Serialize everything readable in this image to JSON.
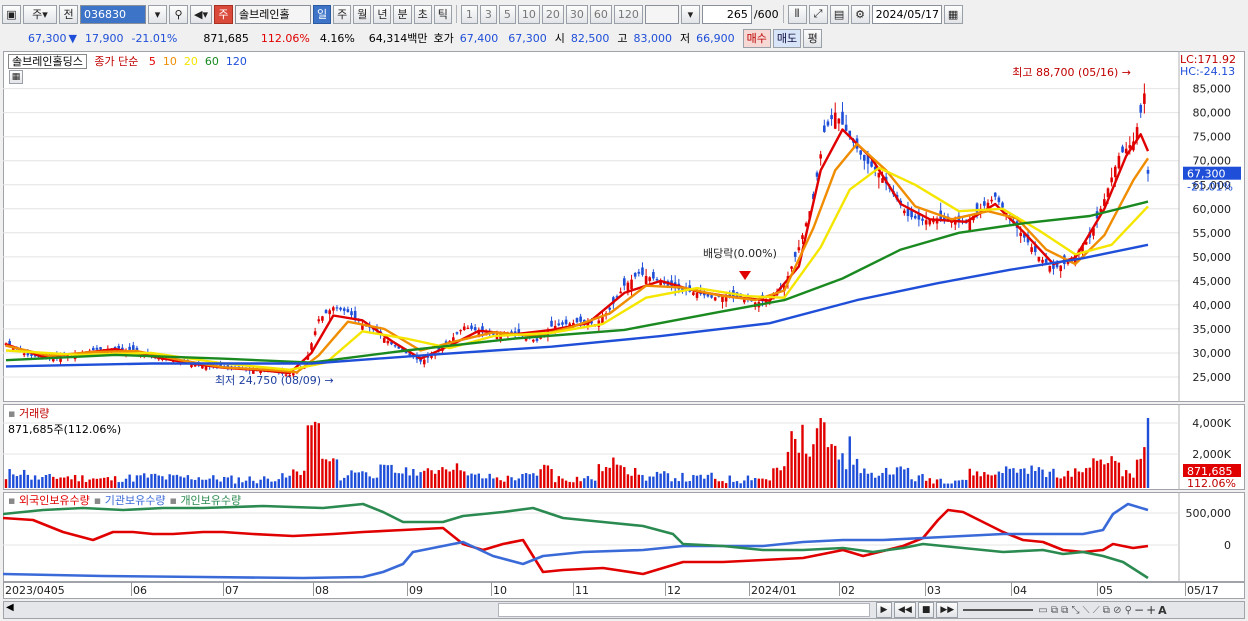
{
  "toolbar": {
    "market_label": "주",
    "type_label": "전",
    "code": "036830",
    "stock_name": "솔브레인홀",
    "stock_badge": "주",
    "periods": [
      "일",
      "주",
      "월",
      "년",
      "분",
      "초",
      "틱"
    ],
    "selected_period": "일",
    "minute_options": [
      "1",
      "3",
      "5",
      "10",
      "20",
      "30",
      "60",
      "120"
    ],
    "range_count": "265",
    "range_total": "/600",
    "date": "2024/05/17"
  },
  "quote": {
    "price": "67,300",
    "arrow": "▼",
    "change": "17,900",
    "change_pct": "-21.01%",
    "volume": "871,685",
    "volume_ratio": "112.06%",
    "turnover": "4.16%",
    "amount": "64,314백만",
    "bid_label": "호가",
    "ask_price": "67,400",
    "bid_price": "67,300",
    "open_label": "시",
    "open": "82,500",
    "high_label": "고",
    "high": "83,000",
    "low_label": "저",
    "low": "66,900",
    "buy_label": "매수",
    "sell_label": "매도",
    "eval_label": "평"
  },
  "chart_data": {
    "type": "candlestick",
    "stock": "솔브레인홀딩스",
    "legend": {
      "close_label": "종가 단순",
      "ma_periods": [
        "5",
        "10",
        "20",
        "60",
        "120"
      ],
      "ma_colors": [
        "#e00000",
        "#f08c00",
        "#f5e600",
        "#1a8a20",
        "#1f4fd8"
      ]
    },
    "ylim": [
      20000,
      92000
    ],
    "y_ticks": [
      25000,
      30000,
      35000,
      40000,
      45000,
      50000,
      55000,
      60000,
      65000,
      70000,
      75000,
      80000,
      85000
    ],
    "y_tick_labels": [
      "25,000",
      "30,000",
      "35,000",
      "40,000",
      "45,000",
      "50,000",
      "55,000",
      "60,000",
      "65,000",
      "70,000",
      "75,000",
      "80,000",
      "85,000"
    ],
    "x_labels": [
      "2023/04",
      "05",
      "06",
      "07",
      "08",
      "09",
      "10",
      "11",
      "12",
      "2024/01",
      "02",
      "03",
      "04",
      "05",
      "05/17"
    ],
    "annotations": {
      "high": "최고 88,700 (05/16)",
      "low": "최저 24,750 (08/09)",
      "dividend": "배당락(0.00%)",
      "lc": "LC:171.92",
      "hc": "HC:-24.13",
      "last_price": "67,300",
      "last_pct": "-21.01%"
    },
    "close_trend": [
      [
        0,
        32000
      ],
      [
        6,
        29500
      ],
      [
        12,
        28800
      ],
      [
        18,
        29800
      ],
      [
        24,
        30600
      ],
      [
        30,
        31000
      ],
      [
        36,
        30200
      ],
      [
        42,
        29000
      ],
      [
        48,
        28200
      ],
      [
        54,
        27300
      ],
      [
        60,
        26800
      ],
      [
        66,
        26500
      ],
      [
        72,
        26200
      ],
      [
        78,
        25400
      ],
      [
        82,
        27000
      ],
      [
        86,
        37000
      ],
      [
        90,
        39500
      ],
      [
        94,
        38500
      ],
      [
        98,
        36000
      ],
      [
        102,
        34500
      ],
      [
        106,
        31800
      ],
      [
        110,
        30000
      ],
      [
        114,
        28200
      ],
      [
        118,
        29800
      ],
      [
        122,
        32500
      ],
      [
        126,
        35500
      ],
      [
        130,
        34500
      ],
      [
        134,
        33800
      ],
      [
        138,
        34200
      ],
      [
        142,
        33500
      ],
      [
        146,
        32500
      ],
      [
        150,
        35500
      ],
      [
        154,
        36000
      ],
      [
        158,
        36500
      ],
      [
        162,
        36000
      ],
      [
        166,
        39000
      ],
      [
        170,
        44000
      ],
      [
        174,
        46500
      ],
      [
        178,
        45500
      ],
      [
        182,
        44000
      ],
      [
        186,
        43000
      ],
      [
        190,
        42500
      ],
      [
        194,
        41500
      ],
      [
        198,
        41800
      ],
      [
        202,
        41500
      ],
      [
        206,
        40500
      ],
      [
        210,
        41000
      ],
      [
        214,
        44000
      ],
      [
        218,
        52000
      ],
      [
        222,
        62000
      ],
      [
        225,
        76000
      ],
      [
        228,
        80000
      ],
      [
        232,
        75000
      ],
      [
        236,
        70000
      ],
      [
        240,
        67500
      ],
      [
        244,
        63000
      ],
      [
        248,
        58500
      ],
      [
        252,
        57500
      ],
      [
        256,
        58000
      ],
      [
        260,
        57500
      ],
      [
        264,
        57000
      ],
      [
        268,
        60000
      ],
      [
        272,
        62500
      ],
      [
        276,
        58000
      ],
      [
        280,
        54000
      ],
      [
        284,
        50000
      ],
      [
        288,
        47500
      ],
      [
        291,
        48500
      ],
      [
        294,
        50500
      ],
      [
        298,
        54000
      ],
      [
        302,
        62000
      ],
      [
        306,
        71000
      ],
      [
        310,
        74000
      ],
      [
        312,
        80000
      ],
      [
        313,
        84000
      ],
      [
        314,
        67300
      ]
    ],
    "moving_averages": [
      {
        "name": "5",
        "color": "#e00000",
        "points": [
          [
            0,
            31800
          ],
          [
            10,
            29200
          ],
          [
            20,
            29900
          ],
          [
            30,
            30800
          ],
          [
            40,
            29300
          ],
          [
            50,
            27900
          ],
          [
            60,
            26900
          ],
          [
            70,
            26400
          ],
          [
            78,
            25800
          ],
          [
            84,
            30000
          ],
          [
            90,
            37800
          ],
          [
            98,
            36800
          ],
          [
            106,
            32500
          ],
          [
            114,
            28800
          ],
          [
            122,
            31500
          ],
          [
            130,
            34600
          ],
          [
            140,
            33900
          ],
          [
            150,
            34800
          ],
          [
            160,
            36200
          ],
          [
            170,
            42500
          ],
          [
            180,
            45000
          ],
          [
            190,
            42800
          ],
          [
            200,
            41600
          ],
          [
            210,
            40900
          ],
          [
            218,
            48000
          ],
          [
            224,
            68000
          ],
          [
            230,
            76500
          ],
          [
            238,
            70500
          ],
          [
            246,
            61000
          ],
          [
            254,
            57800
          ],
          [
            264,
            57300
          ],
          [
            272,
            61000
          ],
          [
            280,
            55000
          ],
          [
            288,
            48500
          ],
          [
            294,
            49800
          ],
          [
            302,
            60000
          ],
          [
            308,
            71000
          ],
          [
            312,
            75500
          ],
          [
            314,
            72000
          ]
        ]
      },
      {
        "name": "10",
        "color": "#f08c00",
        "points": [
          [
            0,
            31500
          ],
          [
            12,
            29400
          ],
          [
            24,
            30200
          ],
          [
            36,
            30400
          ],
          [
            48,
            28500
          ],
          [
            60,
            27000
          ],
          [
            72,
            26500
          ],
          [
            80,
            26000
          ],
          [
            86,
            29500
          ],
          [
            94,
            36500
          ],
          [
            104,
            35000
          ],
          [
            114,
            30500
          ],
          [
            124,
            32500
          ],
          [
            134,
            34300
          ],
          [
            146,
            33500
          ],
          [
            156,
            35500
          ],
          [
            166,
            38200
          ],
          [
            176,
            44000
          ],
          [
            186,
            43600
          ],
          [
            196,
            42000
          ],
          [
            206,
            41000
          ],
          [
            214,
            43000
          ],
          [
            222,
            56000
          ],
          [
            228,
            68000
          ],
          [
            234,
            73500
          ],
          [
            242,
            68000
          ],
          [
            250,
            60500
          ],
          [
            260,
            57800
          ],
          [
            270,
            59500
          ],
          [
            278,
            58000
          ],
          [
            286,
            51500
          ],
          [
            294,
            48500
          ],
          [
            302,
            54500
          ],
          [
            310,
            66000
          ],
          [
            314,
            70500
          ]
        ]
      },
      {
        "name": "20",
        "color": "#f5e600",
        "points": [
          [
            0,
            30500
          ],
          [
            20,
            29600
          ],
          [
            40,
            30000
          ],
          [
            60,
            27800
          ],
          [
            78,
            26500
          ],
          [
            88,
            28000
          ],
          [
            98,
            34500
          ],
          [
            110,
            33000
          ],
          [
            122,
            31000
          ],
          [
            134,
            33500
          ],
          [
            150,
            34200
          ],
          [
            164,
            36000
          ],
          [
            176,
            41500
          ],
          [
            190,
            43500
          ],
          [
            204,
            41800
          ],
          [
            214,
            41500
          ],
          [
            224,
            52000
          ],
          [
            232,
            64000
          ],
          [
            240,
            68500
          ],
          [
            250,
            65000
          ],
          [
            262,
            59500
          ],
          [
            274,
            60000
          ],
          [
            284,
            55500
          ],
          [
            294,
            50500
          ],
          [
            304,
            52500
          ],
          [
            314,
            60500
          ]
        ]
      },
      {
        "name": "60",
        "color": "#1a8a20",
        "points": [
          [
            0,
            28500
          ],
          [
            30,
            29600
          ],
          [
            60,
            28800
          ],
          [
            84,
            28000
          ],
          [
            110,
            30500
          ],
          [
            140,
            33000
          ],
          [
            170,
            34800
          ],
          [
            196,
            38500
          ],
          [
            214,
            41000
          ],
          [
            230,
            45500
          ],
          [
            246,
            51500
          ],
          [
            262,
            55000
          ],
          [
            280,
            57000
          ],
          [
            298,
            58500
          ],
          [
            314,
            61500
          ]
        ]
      },
      {
        "name": "120",
        "color": "#1f4fd8",
        "points": [
          [
            0,
            27200
          ],
          [
            40,
            27800
          ],
          [
            84,
            27800
          ],
          [
            120,
            29800
          ],
          [
            150,
            31300
          ],
          [
            180,
            33500
          ],
          [
            210,
            36200
          ],
          [
            234,
            41000
          ],
          [
            256,
            44500
          ],
          [
            276,
            47300
          ],
          [
            296,
            49700
          ],
          [
            314,
            52500
          ]
        ]
      }
    ],
    "volume": {
      "label": "거래량",
      "readout": "871,685주(112.06%)",
      "y_ticks": [
        "4,000K",
        "2,000K"
      ],
      "last_value": "871,685",
      "last_pct": "112.06%"
    },
    "holdings": {
      "series_labels": [
        "외국인보유수량",
        "기관보유수량",
        "개인보유수량"
      ],
      "series_colors": [
        "#e00000",
        "#3a6ad8",
        "#2a8a50"
      ],
      "y_ticks": [
        "500,000",
        "0"
      ]
    }
  },
  "scrollbar": {
    "date_label": "05/17"
  },
  "colors": {
    "up": "#e00000",
    "down": "#1f4fd8"
  }
}
